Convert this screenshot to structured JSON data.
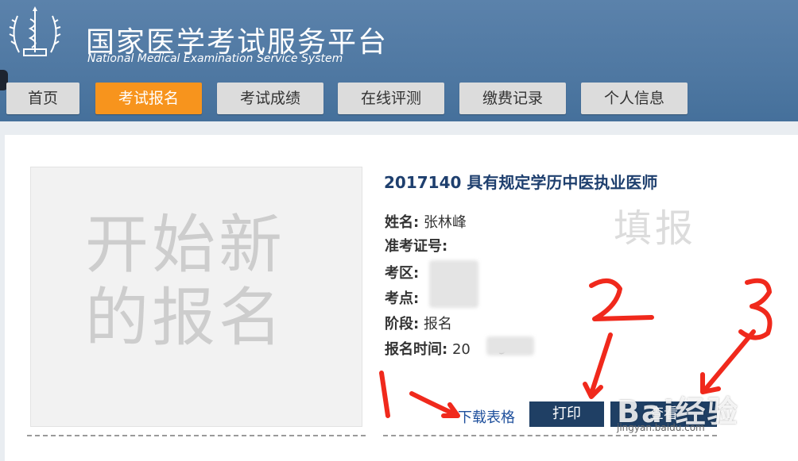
{
  "header": {
    "title": "国家医学考试服务平台",
    "subtitle": "National Medical Examination Service System"
  },
  "nav": {
    "tabs": [
      {
        "label": "首页",
        "active": false
      },
      {
        "label": "考试报名",
        "active": true
      },
      {
        "label": "考试成绩",
        "active": false
      },
      {
        "label": "在线评测",
        "active": false
      },
      {
        "label": "缴费记录",
        "active": false
      },
      {
        "label": "个人信息",
        "active": false
      }
    ]
  },
  "new_registration": {
    "label": "开始新的报名"
  },
  "registration": {
    "title": "2017140 具有规定学历中医执业医师",
    "status_watermark": "填报",
    "fields": [
      {
        "label": "姓名:",
        "value": "张林峰"
      },
      {
        "label": "准考证号:",
        "value": ""
      },
      {
        "label": "考区:",
        "value": ""
      },
      {
        "label": "考点:",
        "value": ""
      },
      {
        "label": "阶段:",
        "value": "报名"
      },
      {
        "label": "报名时间:",
        "value": "20      9"
      }
    ],
    "actions": {
      "download": "下载表格",
      "print": "打印",
      "view": "查看"
    }
  },
  "annotations": [
    "1",
    "2",
    "3"
  ],
  "watermark": {
    "brand": "Bai经验",
    "url": "jingyan.baidu.com"
  },
  "colors": {
    "header": "#4f78a2",
    "active_tab": "#f7941d",
    "button": "#1f3f64",
    "annotation": "#f0291c",
    "title_text": "#1e3f6e"
  }
}
